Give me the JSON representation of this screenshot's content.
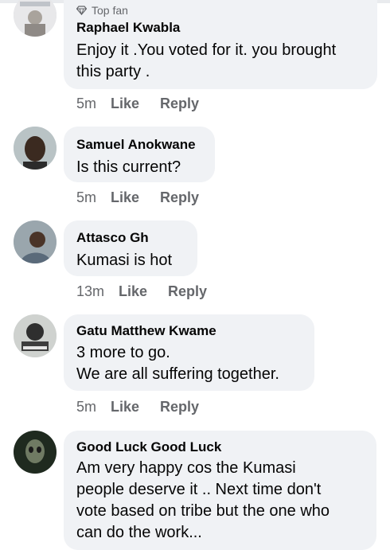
{
  "comments": [
    {
      "badge": "Top fan",
      "author": "Raphael Kwabla",
      "lines": [
        "Enjoy it .You voted for it. you brought",
        "this party ."
      ],
      "time": "5m",
      "like_label": "Like",
      "reply_label": "Reply"
    },
    {
      "author": "Samuel Anokwane",
      "lines": [
        "Is this current?"
      ],
      "time": "5m",
      "like_label": "Like",
      "reply_label": "Reply"
    },
    {
      "author": "Attasco Gh",
      "lines": [
        "Kumasi is hot"
      ],
      "time": "13m",
      "like_label": "Like",
      "reply_label": "Reply"
    },
    {
      "author": "Gatu Matthew Kwame",
      "lines": [
        "3 more to go.",
        "We are all suffering together."
      ],
      "time": "5m",
      "like_label": "Like",
      "reply_label": "Reply"
    },
    {
      "author": "Good Luck Good Luck",
      "lines": [
        "Am very happy cos the Kumasi",
        "people deserve it .. Next time don't",
        "vote based on tribe but the one who",
        "can do the work..."
      ]
    }
  ],
  "colors": {
    "bubble": "#f0f2f5",
    "secondary_text": "#65676b",
    "primary_text": "#050505"
  },
  "icons": {
    "badge": "diamond-icon"
  }
}
